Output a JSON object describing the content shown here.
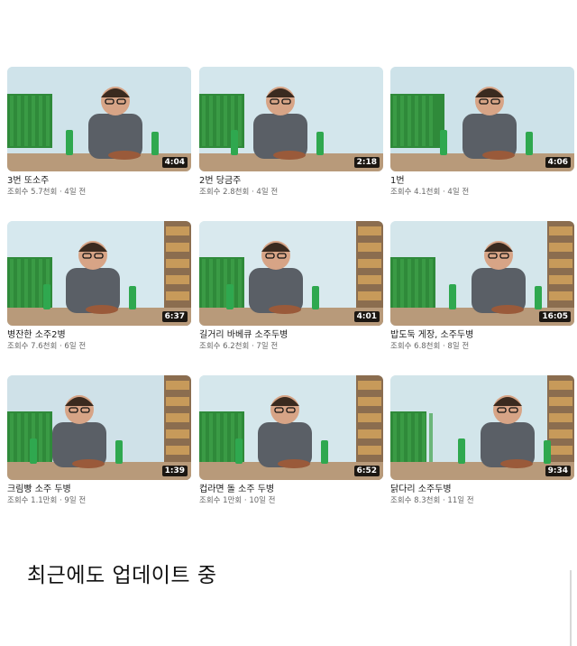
{
  "caption": "최근에도 업데이트 중",
  "videos": [
    {
      "title": "3번 또소주",
      "meta": "조회수 5.7천회 · 4일 전",
      "duration": "4:04",
      "variant": 0
    },
    {
      "title": "2번 당금주",
      "meta": "조회수 2.8천회 · 4일 전",
      "duration": "2:18",
      "variant": 1
    },
    {
      "title": "1번",
      "meta": "조회수 4.1천회 · 4일 전",
      "duration": "4:06",
      "variant": 2
    },
    {
      "title": "병잔한 소주2병",
      "meta": "조회수 7.6천회 · 6일 전",
      "duration": "6:37",
      "variant": 3
    },
    {
      "title": "길거리 바베큐 소주두병",
      "meta": "조회수 6.2천회 · 7일 전",
      "duration": "4:01",
      "variant": 4
    },
    {
      "title": "밥도둑 게장, 소주두병",
      "meta": "조회수 6.8천회 · 8일 전",
      "duration": "16:05",
      "variant": 5
    },
    {
      "title": "크림빵 소주 두병",
      "meta": "조회수 1.1만회 · 9일 전",
      "duration": "1:39",
      "variant": 6
    },
    {
      "title": "컵라면 돌 소주 두병",
      "meta": "조회수 1만회 · 10일 전",
      "duration": "6:52",
      "variant": 7
    },
    {
      "title": "닭다리 소주두병",
      "meta": "조회수 8.3천회 · 11일 전",
      "duration": "9:34",
      "variant": 8
    }
  ]
}
